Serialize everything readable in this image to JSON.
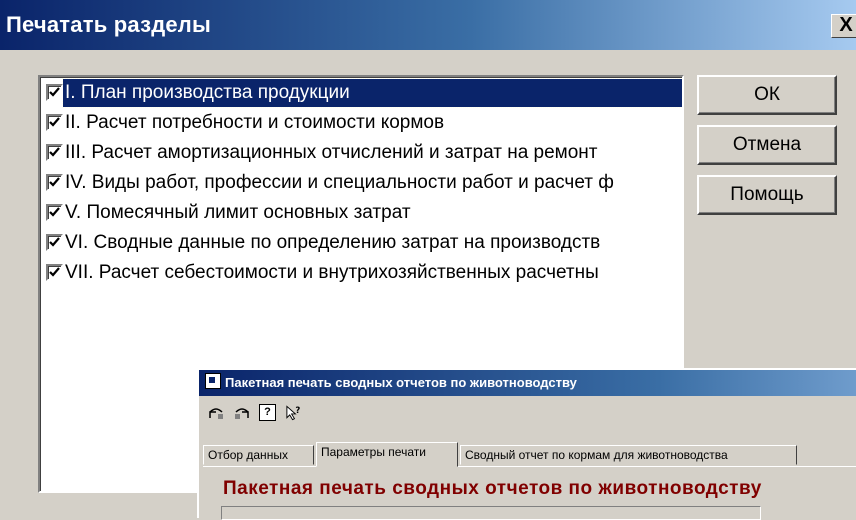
{
  "dialog": {
    "title": "Печатать разделы",
    "close_label": "X"
  },
  "list": {
    "items": [
      {
        "label": "I. План производства продукции",
        "checked": true,
        "selected": true
      },
      {
        "label": "II. Расчет потребности и стоимости кормов",
        "checked": true,
        "selected": false
      },
      {
        "label": "III. Расчет амортизационных отчислений и затрат на ремонт",
        "checked": true,
        "selected": false
      },
      {
        "label": "IV. Виды работ, профессии и специальности работ и расчет ф",
        "checked": true,
        "selected": false
      },
      {
        "label": "V. Помесячный лимит основных затрат",
        "checked": true,
        "selected": false
      },
      {
        "label": "VI. Сводные данные по определению затрат на производств",
        "checked": true,
        "selected": false
      },
      {
        "label": "VII. Расчет себестоимости и внутрихозяйственных расчетны",
        "checked": true,
        "selected": false
      }
    ]
  },
  "buttons": {
    "ok": "ОК",
    "cancel": "Отмена",
    "help": "Помощь"
  },
  "overlay": {
    "title": "Пакетная печать сводных отчетов по животноводству",
    "tabs": [
      {
        "label": "Отбор данных",
        "active": false
      },
      {
        "label": "Параметры печати",
        "active": true
      },
      {
        "label": "Сводный отчет по кормам для животноводства",
        "active": false
      }
    ],
    "heading": "Пакетная печать сводных отчетов по животноводству",
    "toolbar_icons": [
      "undo-icon",
      "redo-icon",
      "help-icon",
      "context-help-icon"
    ]
  },
  "colors": {
    "titlebar": "#0a246a",
    "selection": "#0a246a",
    "heading": "#800000",
    "face": "#d4d0c8"
  }
}
